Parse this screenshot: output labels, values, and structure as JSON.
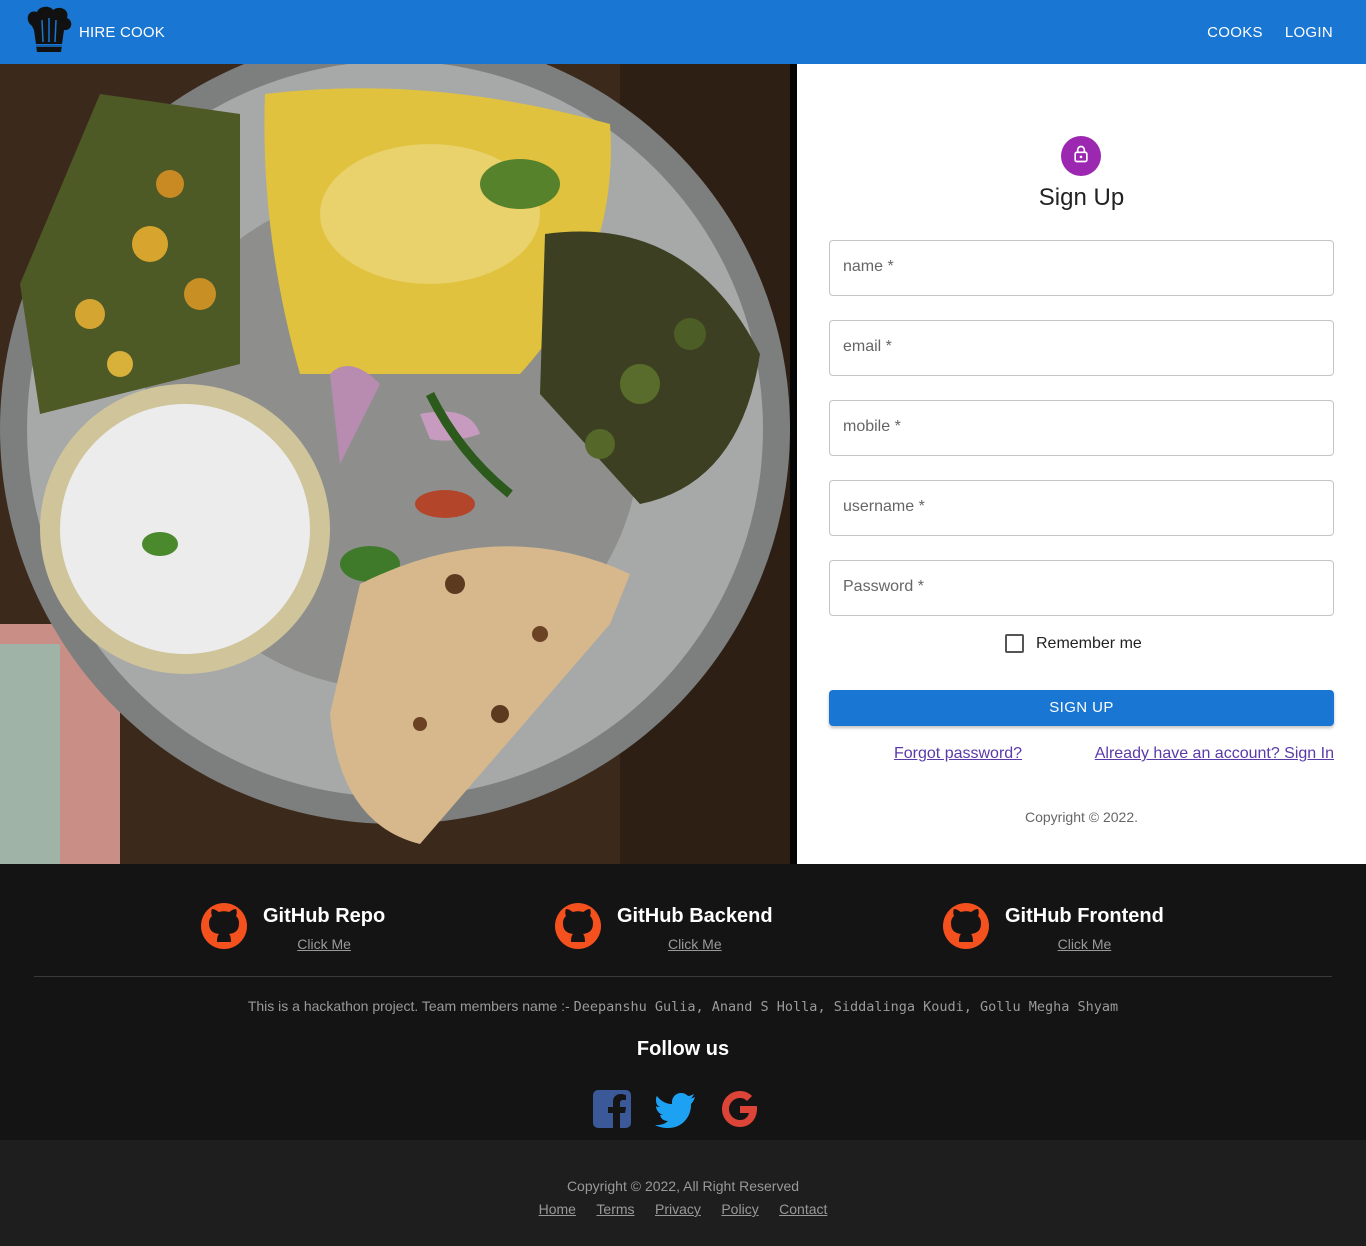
{
  "appbar": {
    "brand": "HIRE COOK",
    "nav": [
      "COOKS",
      "LOGIN"
    ],
    "color": "#1976d2"
  },
  "form": {
    "title": "Sign Up",
    "fields": [
      {
        "placeholder": "name *"
      },
      {
        "placeholder": "email *"
      },
      {
        "placeholder": "mobile *"
      },
      {
        "placeholder": "username *"
      },
      {
        "placeholder": "Password *"
      }
    ],
    "remember_label": "Remember me",
    "submit_label": "SIGN UP",
    "forgot_link": "Forgot password?",
    "signin_link": "Already have an account? Sign In",
    "copyright": "Copyright © 2022.",
    "avatar_color": "#9c27b0"
  },
  "footer": {
    "repos": [
      {
        "title": "GitHub Repo",
        "link": "Click Me"
      },
      {
        "title": "GitHub Backend",
        "link": "Click Me"
      },
      {
        "title": "GitHub Frontend",
        "link": "Click Me"
      }
    ],
    "team_prefix": "This is a hackathon project. Team members name :-",
    "team_names": "Deepanshu Gulia, Anand S Holla, Siddalinga Koudi, Gollu Megha Shyam",
    "follow": "Follow us",
    "socials": [
      "facebook-icon",
      "twitter-icon",
      "google-icon"
    ],
    "copyright": "Copyright © 2022, All Right Reserved",
    "links": [
      "Home",
      "Terms",
      "Privacy",
      "Policy",
      "Contact"
    ],
    "github_color": "#f4511e"
  }
}
